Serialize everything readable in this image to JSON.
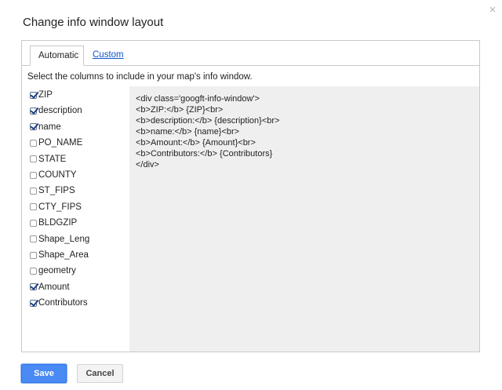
{
  "dialog": {
    "title": "Change info window layout",
    "close_glyph": "×"
  },
  "tabs": [
    {
      "label": "Automatic",
      "active": true
    },
    {
      "label": "Custom",
      "active": false
    }
  ],
  "instructions": "Select the columns to include in your map's info window.",
  "columns": [
    {
      "label": "ZIP",
      "checked": true
    },
    {
      "label": "description",
      "checked": true
    },
    {
      "label": "name",
      "checked": true
    },
    {
      "label": "PO_NAME",
      "checked": false
    },
    {
      "label": "STATE",
      "checked": false
    },
    {
      "label": "COUNTY",
      "checked": false
    },
    {
      "label": "ST_FIPS",
      "checked": false
    },
    {
      "label": "CTY_FIPS",
      "checked": false
    },
    {
      "label": "BLDGZIP",
      "checked": false
    },
    {
      "label": "Shape_Leng",
      "checked": false
    },
    {
      "label": "Shape_Area",
      "checked": false
    },
    {
      "label": "geometry",
      "checked": false
    },
    {
      "label": "Amount",
      "checked": true
    },
    {
      "label": "Contributors",
      "checked": true
    }
  ],
  "preview_lines": [
    "<div class='googft-info-window'>",
    "<b>ZIP:</b> {ZIP}<br>",
    "<b>description:</b> {description}<br>",
    "<b>name:</b> {name}<br>",
    "<b>Amount:</b> {Amount}<br>",
    "<b>Contributors:</b> {Contributors}",
    "</div>"
  ],
  "buttons": {
    "save": "Save",
    "cancel": "Cancel"
  }
}
